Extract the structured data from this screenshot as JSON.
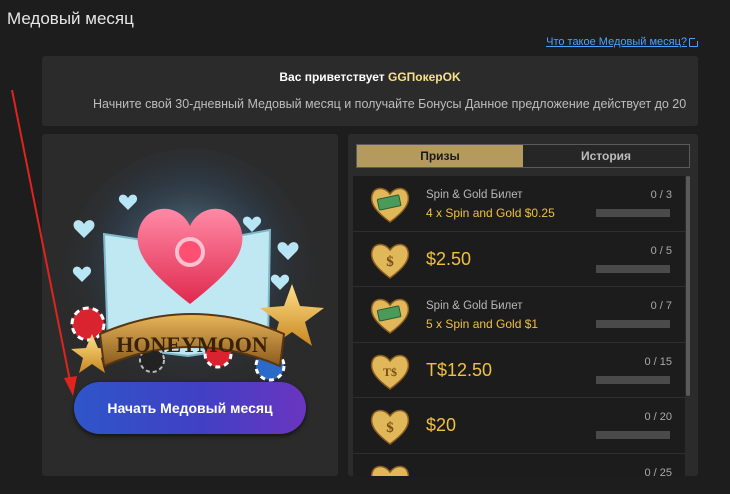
{
  "page": {
    "title": "Медовый месяц"
  },
  "help_link": {
    "label": "Что такое Медовый месяц?"
  },
  "welcome": {
    "greeting_prefix": "Вас приветствует",
    "brand": "GGПокерOK",
    "promo": "Начните свой 30-дневный Медовый месяц и получайте Бонусы Данное предложение действует до 20"
  },
  "hero": {
    "logo_text": "HONEYMOON",
    "start_button_label": "Начать Медовый месяц"
  },
  "tabs": [
    {
      "label": "Призы",
      "active": true
    },
    {
      "label": "История",
      "active": false
    }
  ],
  "prizes": [
    {
      "icon": "ticket-heart-icon",
      "title": "Spin & Gold Билет",
      "subtitle": "4 x Spin and Gold $0.25",
      "count": "0 / 3",
      "progress": 0
    },
    {
      "icon": "dollar-heart-icon",
      "glyph": "$",
      "amount": "$2.50",
      "count": "0 / 5",
      "progress": 0
    },
    {
      "icon": "ticket-heart-icon",
      "title": "Spin & Gold Билет",
      "subtitle": "5 x Spin and Gold $1",
      "count": "0 / 7",
      "progress": 0
    },
    {
      "icon": "tdollar-heart-icon",
      "glyph": "T$",
      "amount": "T$12.50",
      "count": "0 / 15",
      "progress": 0
    },
    {
      "icon": "dollar-heart-icon",
      "glyph": "$",
      "amount": "$20",
      "count": "0 / 20",
      "progress": 0
    },
    {
      "icon": "heart-icon",
      "count": "0 / 25",
      "progress": 0
    }
  ],
  "colors": {
    "accent_gold": "#f0c040",
    "tab_active": "#b59a5e",
    "button_blue": "#3b4ac6",
    "arrow_red": "#e0231e"
  }
}
